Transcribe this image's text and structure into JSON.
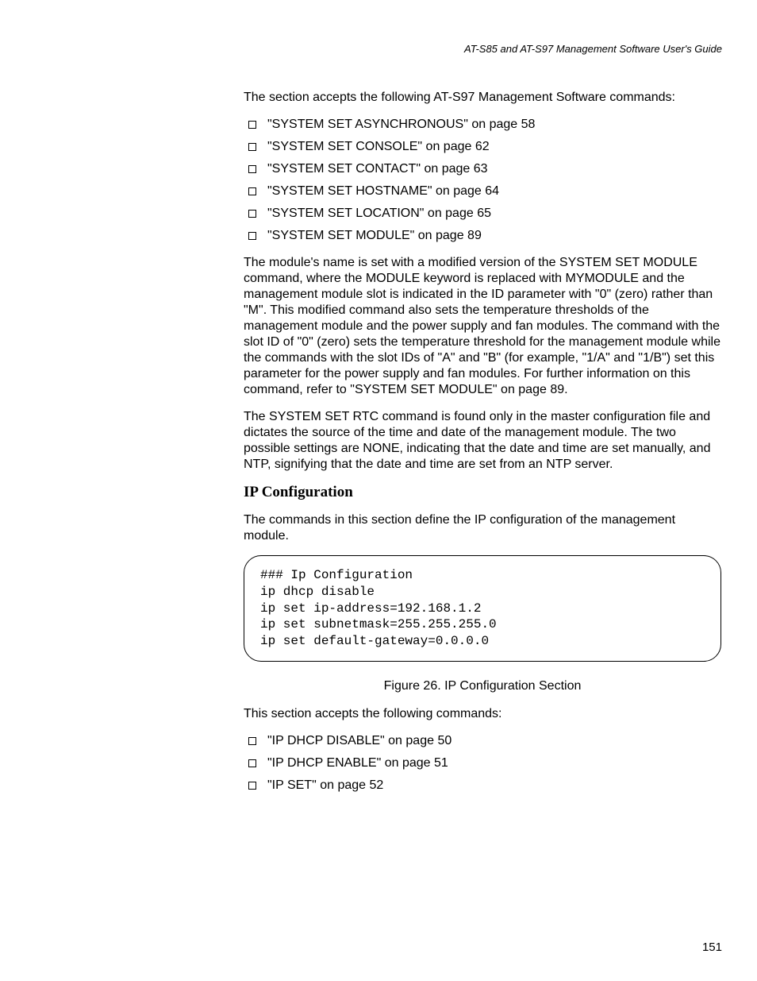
{
  "header": {
    "title": "AT-S85 and AT-S97 Management Software User's Guide"
  },
  "content": {
    "intro_para": "The section accepts the following AT-S97 Management Software commands:",
    "list1": [
      "\"SYSTEM SET ASYNCHRONOUS\" on page 58",
      "\"SYSTEM SET CONSOLE\" on page 62",
      "\"SYSTEM SET CONTACT\" on page 63",
      "\"SYSTEM SET HOSTNAME\" on page 64",
      "\"SYSTEM SET LOCATION\" on page 65",
      "\"SYSTEM SET MODULE\" on page 89"
    ],
    "para_module": "The module's name is set with a modified version of the SYSTEM SET MODULE command, where the MODULE keyword is replaced with MYMODULE and the management module slot is indicated in the ID parameter with \"0\" (zero) rather than \"M\". This modified command also sets the temperature thresholds of the management module and the power supply and fan modules. The command with the slot ID of \"0\" (zero) sets the temperature threshold for the management module while the commands with the slot IDs of \"A\" and \"B\" (for example, \"1/A\" and \"1/B\") set this parameter for the power supply and fan modules. For further information on this command, refer to \"SYSTEM SET MODULE\" on page 89.",
    "para_rtc": "The SYSTEM SET RTC command is found only in the master configuration file and dictates the source of the time and date of the management module. The two possible settings are NONE, indicating that the date and time are set manually, and NTP, signifying that the date and time are set from an NTP server.",
    "subheading_ip": "IP Configuration",
    "para_ip_intro": "The commands in this section define the IP configuration of the management module.",
    "code_block": "### Ip Configuration\nip dhcp disable\nip set ip-address=192.168.1.2\nip set subnetmask=255.255.255.0\nip set default-gateway=0.0.0.0",
    "figure_caption": "Figure 26. IP Configuration Section",
    "para_accepts": "This section accepts the following commands:",
    "list2": [
      "\"IP DHCP DISABLE\" on page 50",
      "\"IP DHCP ENABLE\" on page 51",
      "\"IP SET\" on page 52"
    ]
  },
  "footer": {
    "page_number": "151"
  }
}
